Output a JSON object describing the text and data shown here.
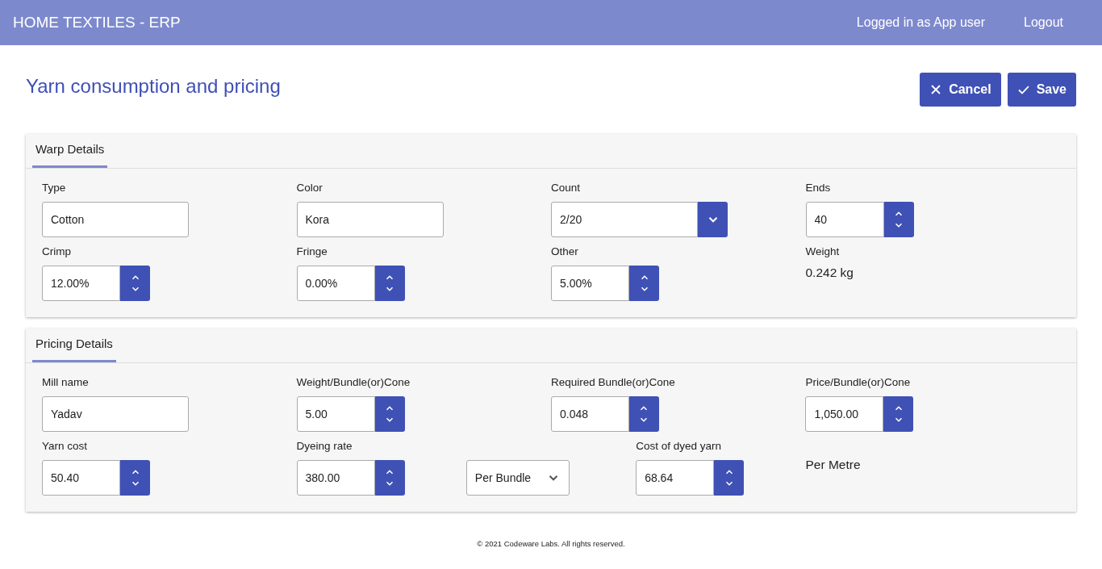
{
  "header": {
    "app_title": "HOME TEXTILES - ERP",
    "user_label": "Logged in as App user",
    "logout": "Logout"
  },
  "page": {
    "title": "Yarn consumption and pricing",
    "buttons": [
      {
        "kind": "cancel",
        "label": "Cancel"
      },
      {
        "kind": "save",
        "label": "Save"
      }
    ]
  },
  "panels": [
    {
      "tab": {
        "label": "Warp Details",
        "selected": true
      },
      "fields": [
        {
          "kind": "text",
          "label": "Type",
          "value": "Cotton"
        },
        {
          "kind": "text",
          "label": "Color",
          "value": "Kora"
        },
        {
          "kind": "dropdown",
          "label": "Count",
          "value": "2/20"
        },
        {
          "kind": "spinner",
          "label": "Ends",
          "value": "40"
        },
        {
          "kind": "spinner",
          "label": "Crimp",
          "value": "12.00%"
        },
        {
          "kind": "spinner",
          "label": "Fringe",
          "value": "0.00%"
        },
        {
          "kind": "spinner",
          "label": "Other",
          "value": "5.00%"
        },
        {
          "kind": "readout",
          "label": "Weight",
          "value": "0.242 kg"
        }
      ]
    },
    {
      "tab": {
        "label": "Pricing Details",
        "selected": true
      },
      "fields": [
        {
          "kind": "text",
          "label": "Mill name",
          "value": "Yadav"
        },
        {
          "kind": "spinner",
          "label": "Weight/Bundle(or)Cone",
          "value": "5.00"
        },
        {
          "kind": "spinner",
          "label": "Required Bundle(or)Cone",
          "value": "0.048"
        },
        {
          "kind": "spinner",
          "label": "Price/Bundle(or)Cone",
          "value": "1,050.00"
        },
        {
          "kind": "spinner",
          "label": "Yarn cost",
          "value": "50.40"
        },
        {
          "kind": "spinner",
          "label": "Dyeing rate",
          "value": "380.00"
        },
        {
          "kind": "select",
          "value": "Per Bundle"
        },
        {
          "kind": "spinner",
          "label": "Cost of dyed yarn",
          "value": "68.64"
        },
        {
          "kind": "readout",
          "value": "Per Metre"
        }
      ]
    }
  ],
  "footer": "© 2021 Codeware Labs. All rights reserved."
}
